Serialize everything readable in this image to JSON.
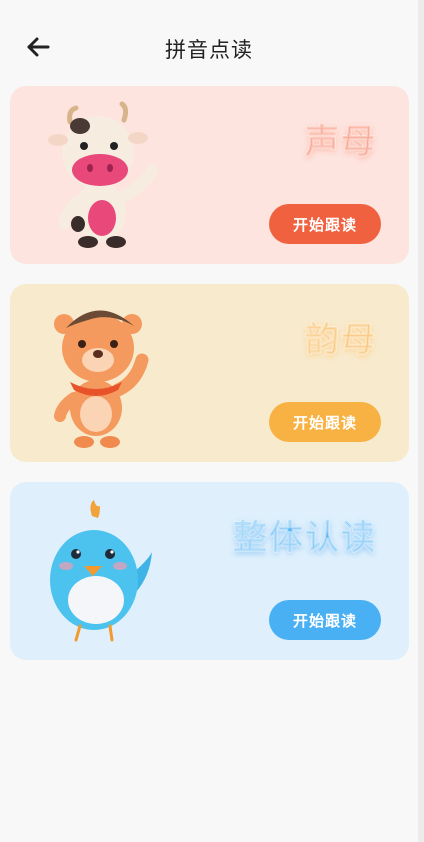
{
  "header": {
    "title": "拼音点读",
    "back_icon": "arrow-left-icon"
  },
  "cards": [
    {
      "heading": "声母",
      "button_label": "开始跟读",
      "mascot": "cow-mascot",
      "accent": "#f0613f",
      "background": "#fde4df"
    },
    {
      "heading": "韵母",
      "button_label": "开始跟读",
      "mascot": "bear-mascot",
      "accent": "#f8b244",
      "background": "#f8eacd"
    },
    {
      "heading": "整体认读",
      "button_label": "开始跟读",
      "mascot": "bird-mascot",
      "accent": "#4ab0f4",
      "background": "#dff0fc"
    }
  ]
}
